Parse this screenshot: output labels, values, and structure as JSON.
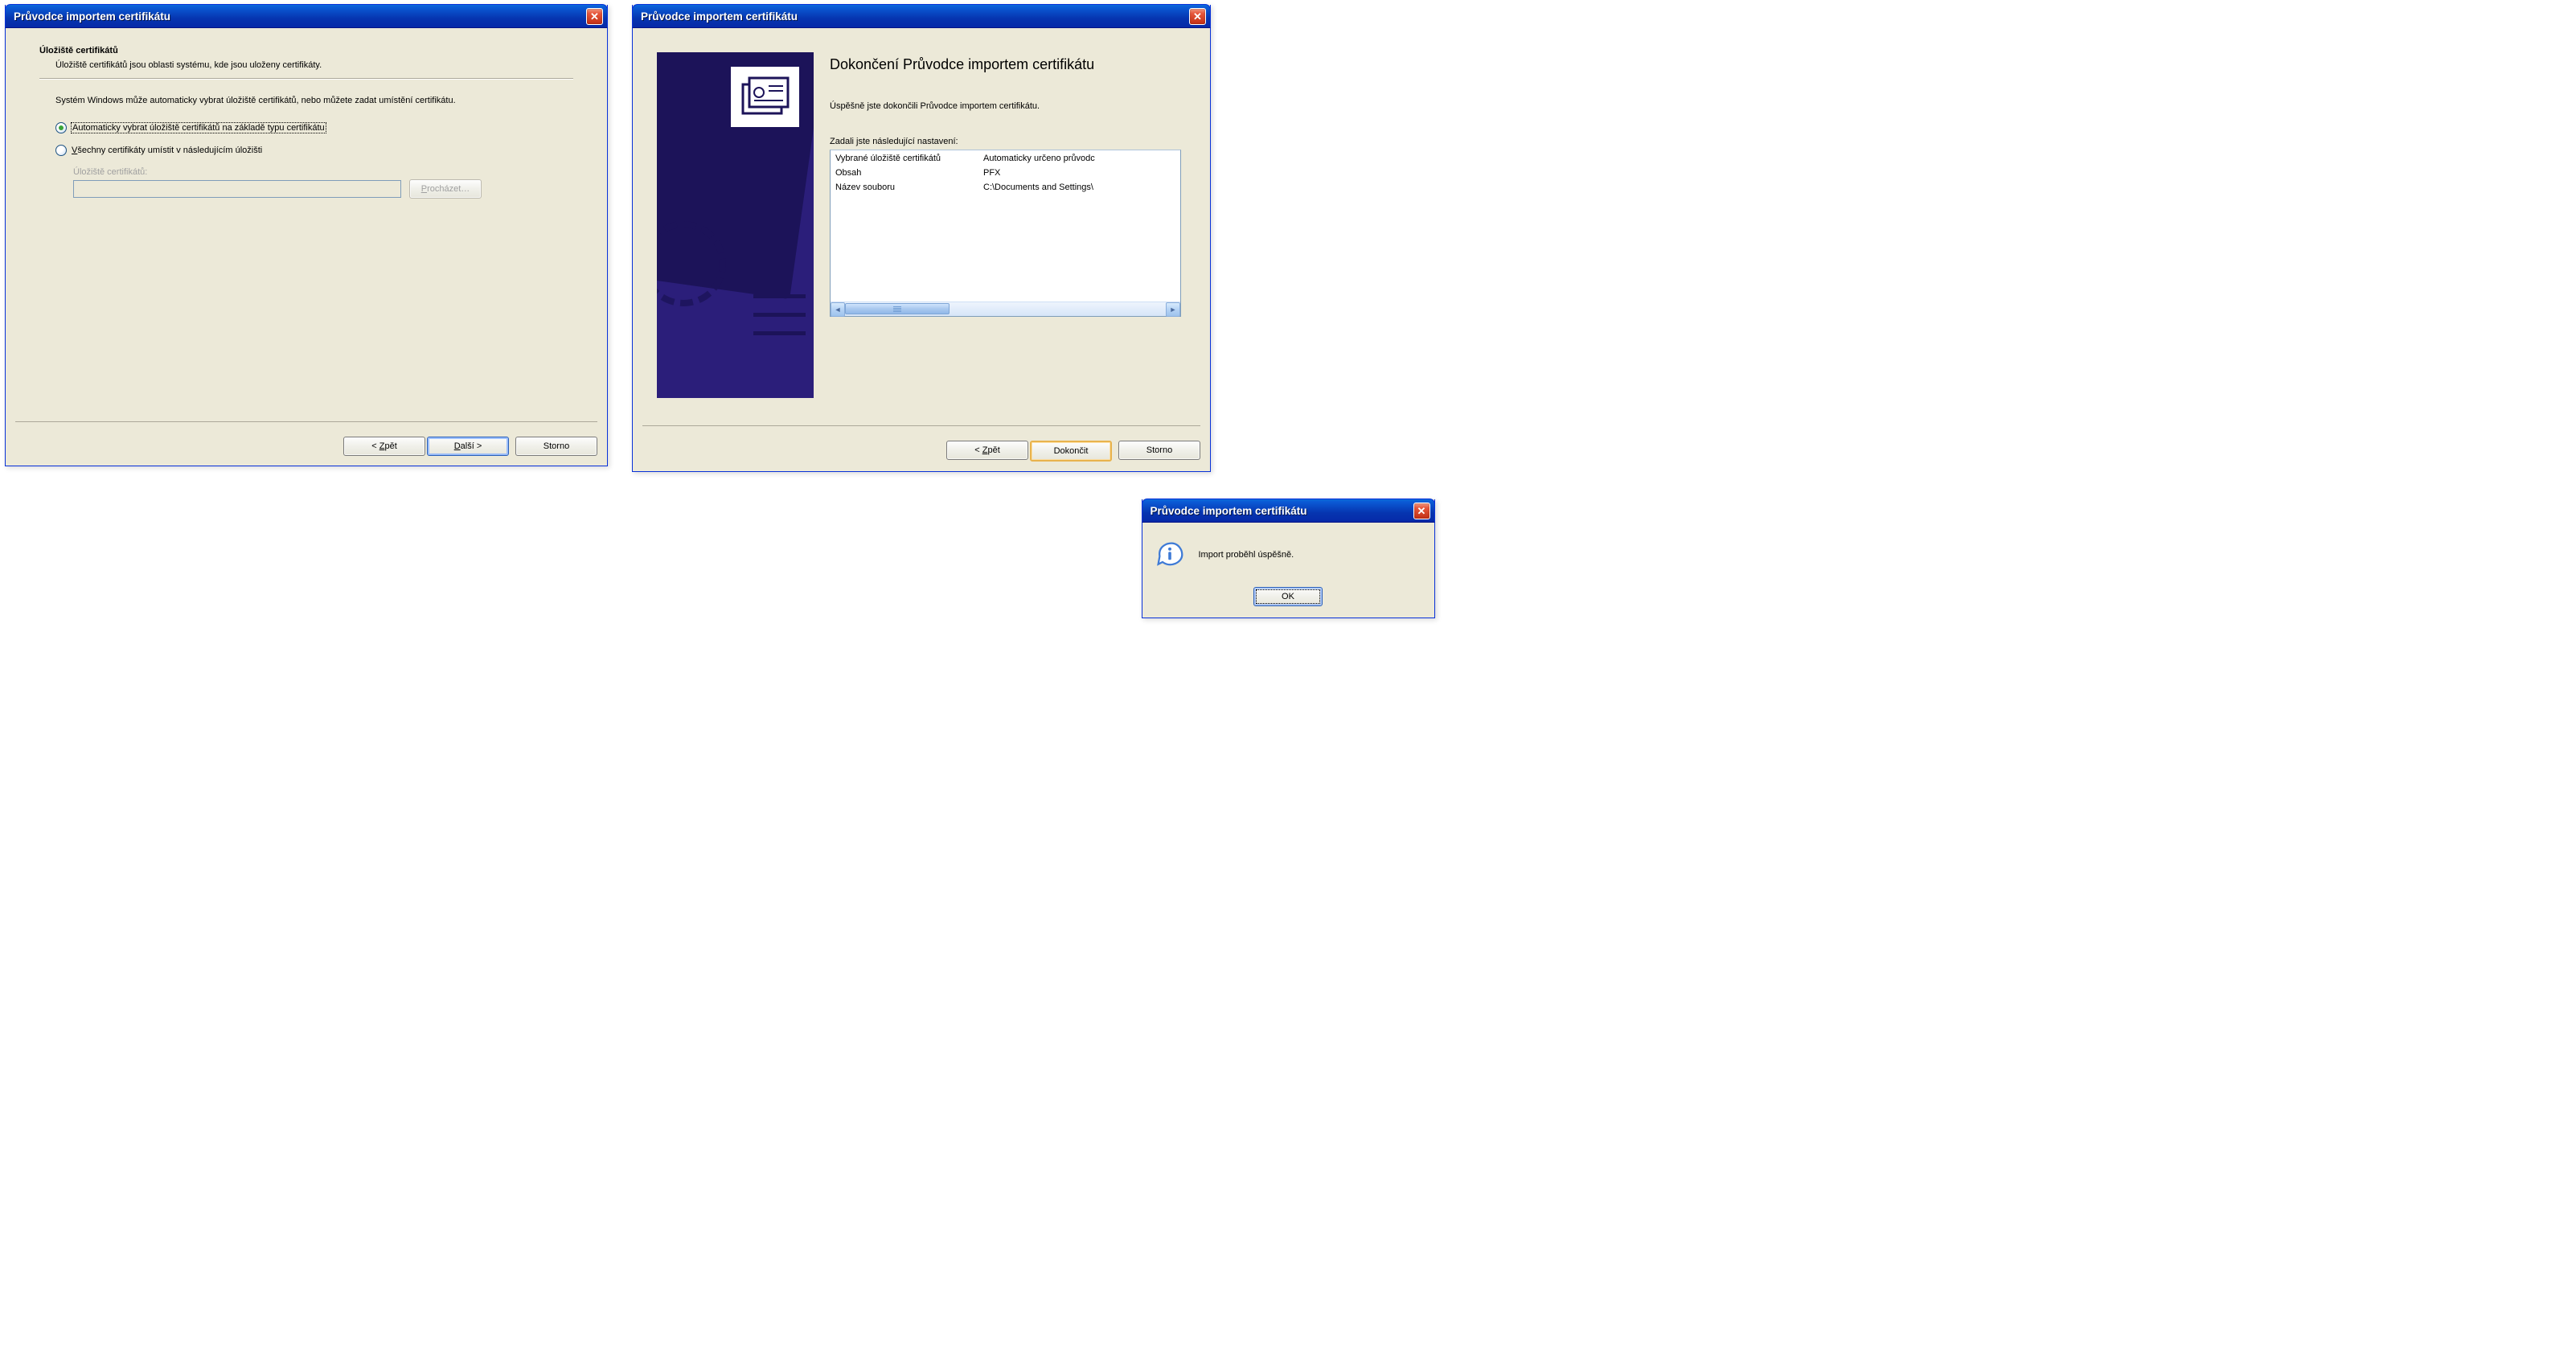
{
  "window1": {
    "title": "Průvodce importem certifikátu",
    "heading": "Úložiště certifikátů",
    "subheading": "Úložiště certifikátů jsou oblasti systému, kde jsou uloženy certifikáty.",
    "instruction": "Systém Windows může automaticky vybrat úložiště certifikátů, nebo můžete zadat umístění certifikátu.",
    "radio1_text": "Automaticky vybrat úložiště certifikátů na základě typu certifikátu",
    "radio2_pre": "V",
    "radio2_rest": "šechny certifikáty umístit v následujícím úložišti",
    "store_field_label": "Úložiště certifikátů:",
    "store_value": "",
    "browse_pre": "P",
    "browse_rest": "rocházet…",
    "back_pre": "< ",
    "back_u": "Z",
    "back_rest": "pět",
    "next_u": "D",
    "next_rest": "alší >",
    "cancel": "Storno"
  },
  "window2": {
    "title": "Průvodce importem certifikátu",
    "heading": "Dokončení Průvodce importem certifikátu",
    "success": "Úspěšně jste dokončili Průvodce importem certifikátu.",
    "settings_label": "Zadali jste následující nastavení:",
    "rows": [
      {
        "key": "Vybrané úložiště certifikátů",
        "val": "Automaticky určeno průvodc"
      },
      {
        "key": "Obsah",
        "val": "PFX"
      },
      {
        "key": "Název souboru",
        "val": "C:\\Documents and Settings\\"
      }
    ],
    "back_pre": "< ",
    "back_u": "Z",
    "back_rest": "pět",
    "finish": "Dokončit",
    "cancel": "Storno"
  },
  "msgbox": {
    "title": "Průvodce importem certifikátu",
    "message": "Import proběhl úspěšně.",
    "ok": "OK"
  }
}
